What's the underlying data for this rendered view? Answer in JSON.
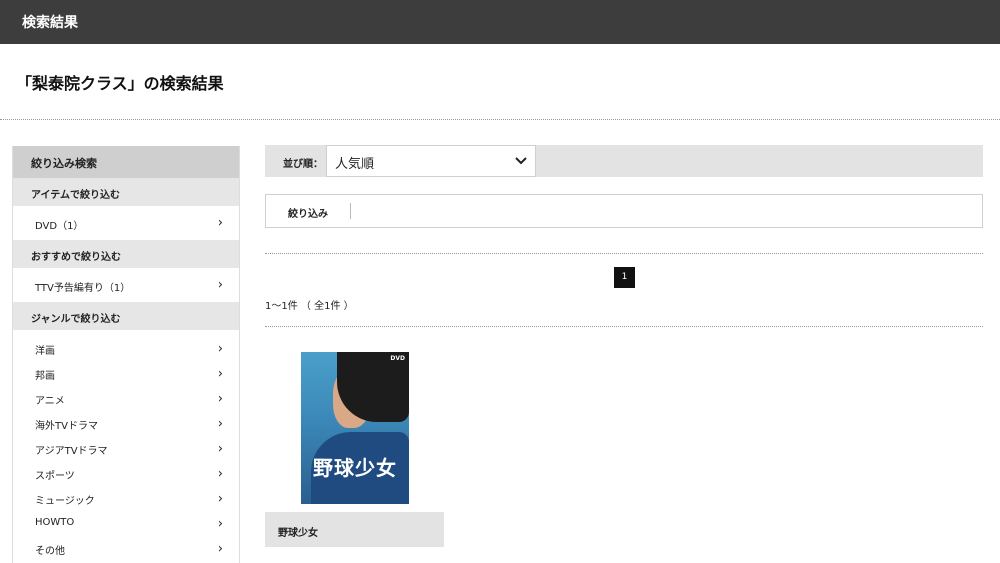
{
  "header": {
    "title": "検索結果"
  },
  "heading": "「梨泰院クラス」の検索結果",
  "sidebar": {
    "title": "絞り込み検索",
    "sections": [
      {
        "label": "アイテムで絞り込む",
        "items": [
          "DVD（1）"
        ]
      },
      {
        "label": "おすすめで絞り込む",
        "items": [
          "TTV予告編有り（1）"
        ]
      },
      {
        "label": "ジャンルで絞り込む",
        "items": [
          "洋画",
          "邦画",
          "アニメ",
          "海外TVドラマ",
          "アジアTVドラマ",
          "スポーツ",
          "ミュージック",
          "HOWTO",
          "その他"
        ]
      }
    ],
    "chevron": "›"
  },
  "sort": {
    "label": "並び順：",
    "selected": "人気順",
    "icon": "chevron-down-icon"
  },
  "filter": {
    "label": "絞り込み"
  },
  "pagination": {
    "current": "1"
  },
  "result_count": "1〜1件 （ 全1件 ）",
  "products": [
    {
      "title": "野球少女",
      "cover_text": "野球少女",
      "cover_badge": "DVD"
    }
  ],
  "colors": {
    "topbar": "#3d3d3d",
    "section": "#e6e6e6",
    "sidebar_head": "#cfcfcf",
    "page_active": "#111111"
  }
}
